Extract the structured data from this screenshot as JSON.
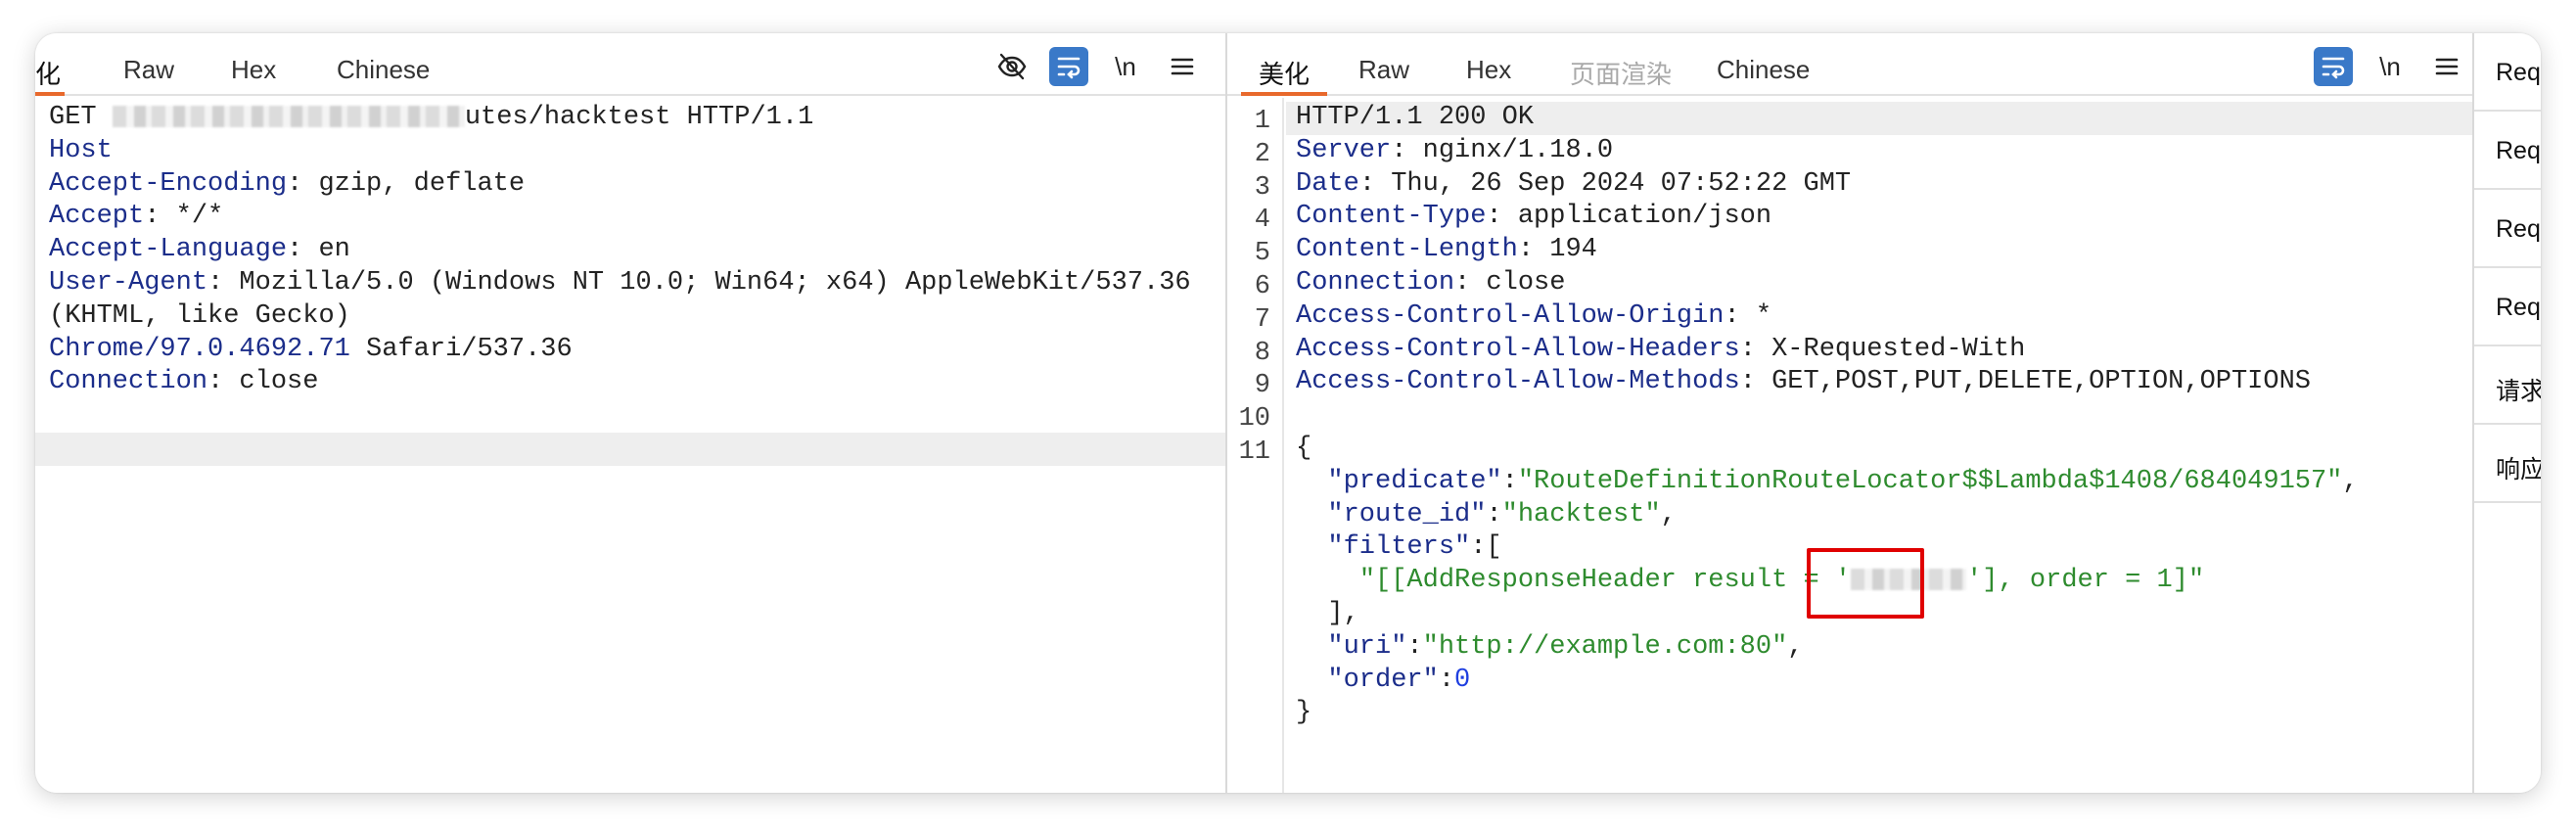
{
  "request_editor": {
    "tabs": [
      "美化",
      "Raw",
      "Hex",
      "Chinese"
    ],
    "active_tab": "美化",
    "tab_visible_clip": "化",
    "toolbar": {
      "newline_label": "\\n"
    },
    "lines": [
      {
        "parts": [
          {
            "t": "GET "
          },
          {
            "t": "",
            "blur": true
          },
          {
            "t": "utes/hacktest HTTP/1.1"
          }
        ]
      },
      {
        "parts": [
          {
            "t": "Host",
            "c": "k"
          }
        ]
      },
      {
        "parts": [
          {
            "t": "Accept-Encoding",
            "c": "k"
          },
          {
            "t": ": gzip, deflate"
          }
        ]
      },
      {
        "parts": [
          {
            "t": "Accept",
            "c": "k"
          },
          {
            "t": ": */*"
          }
        ]
      },
      {
        "parts": [
          {
            "t": "Accept-Language",
            "c": "k"
          },
          {
            "t": ": en"
          }
        ]
      },
      {
        "parts": [
          {
            "t": "User-Agent",
            "c": "k"
          },
          {
            "t": ": Mozilla/5.0 (Windows NT 10.0; Win64; x64) AppleWebKit/537.36"
          }
        ]
      },
      {
        "parts": [
          {
            "t": "(KHTML, like Gecko)"
          }
        ]
      },
      {
        "parts": [
          {
            "t": "Chrome/97.0.4692.71",
            "c": "k"
          },
          {
            "t": " Safari/537.36"
          }
        ]
      },
      {
        "parts": [
          {
            "t": "Connection",
            "c": "k"
          },
          {
            "t": ": close"
          }
        ]
      },
      {
        "parts": []
      },
      {
        "parts": [],
        "highlight": true
      }
    ]
  },
  "response_editor": {
    "tabs": [
      "美化",
      "Raw",
      "Hex",
      "页面渲染",
      "Chinese"
    ],
    "active_tab": "美化",
    "disabled_tab": "页面渲染",
    "toolbar": {
      "newline_label": "\\n"
    },
    "line_numbers": [
      "1",
      "2",
      "3",
      "4",
      "5",
      "6",
      "7",
      "8",
      "9",
      "10",
      "11"
    ],
    "lines": [
      {
        "parts": [
          {
            "t": "HTTP/1.1 200 OK"
          }
        ],
        "highlight": true
      },
      {
        "parts": [
          {
            "t": "Server",
            "c": "k"
          },
          {
            "t": ": nginx/1.18.0"
          }
        ]
      },
      {
        "parts": [
          {
            "t": "Date",
            "c": "k"
          },
          {
            "t": ": Thu, 26 Sep 2024 07:52:22 GMT"
          }
        ]
      },
      {
        "parts": [
          {
            "t": "Content-Type",
            "c": "k"
          },
          {
            "t": ": application/json"
          }
        ]
      },
      {
        "parts": [
          {
            "t": "Content-Length",
            "c": "k"
          },
          {
            "t": ": 194"
          }
        ]
      },
      {
        "parts": [
          {
            "t": "Connection",
            "c": "k"
          },
          {
            "t": ": close"
          }
        ]
      },
      {
        "parts": [
          {
            "t": "Access-Control-Allow-Origin",
            "c": "k"
          },
          {
            "t": ": *"
          }
        ]
      },
      {
        "parts": [
          {
            "t": "Access-Control-Allow-Headers",
            "c": "k"
          },
          {
            "t": ": X-Requested-With"
          }
        ]
      },
      {
        "parts": [
          {
            "t": "Access-Control-Allow-Methods",
            "c": "k"
          },
          {
            "t": ": GET,POST,PUT,DELETE,OPTION,OPTIONS"
          }
        ]
      },
      {
        "parts": []
      },
      {
        "parts": [
          {
            "t": "{"
          }
        ]
      },
      {
        "parts": [
          {
            "t": "  "
          },
          {
            "t": "\"predicate\"",
            "c": "k"
          },
          {
            "t": ":"
          },
          {
            "t": "\"RouteDefinitionRouteLocator$$Lambda$1408/684049157\"",
            "c": "s"
          },
          {
            "t": ","
          }
        ]
      },
      {
        "parts": [
          {
            "t": "  "
          },
          {
            "t": "\"route_id\"",
            "c": "k"
          },
          {
            "t": ":"
          },
          {
            "t": "\"hacktest\"",
            "c": "s"
          },
          {
            "t": ","
          }
        ]
      },
      {
        "parts": [
          {
            "t": "  "
          },
          {
            "t": "\"filters\"",
            "c": "k"
          },
          {
            "t": ":["
          }
        ]
      },
      {
        "parts": [
          {
            "t": "    "
          },
          {
            "t": "\"[[AddResponseHeader result = '",
            "c": "s"
          },
          {
            "t": "",
            "blur": true
          },
          {
            "t": "'], order = 1]\"",
            "c": "s"
          }
        ]
      },
      {
        "parts": [
          {
            "t": "  ],"
          }
        ]
      },
      {
        "parts": [
          {
            "t": "  "
          },
          {
            "t": "\"uri\"",
            "c": "k"
          },
          {
            "t": ":"
          },
          {
            "t": "\"http://example.com:80\"",
            "c": "s"
          },
          {
            "t": ","
          }
        ]
      },
      {
        "parts": [
          {
            "t": "  "
          },
          {
            "t": "\"order\"",
            "c": "k"
          },
          {
            "t": ":"
          },
          {
            "t": "0",
            "c": "n"
          }
        ]
      },
      {
        "parts": [
          {
            "t": "}"
          }
        ]
      }
    ]
  },
  "inspector": {
    "items": [
      "Req",
      "Req",
      "Req",
      "Req",
      "请求",
      "响应"
    ]
  },
  "colors": {
    "accent_tab": "#e8692c",
    "header_key": "#1b2d8a",
    "json_string": "#2e8b2e",
    "json_number": "#1f3fe0",
    "highlight_box": "#e00000",
    "wrap_button": "#3a79c8"
  },
  "icons": [
    "eye-off-icon",
    "wrap-text-icon",
    "menu-icon"
  ]
}
